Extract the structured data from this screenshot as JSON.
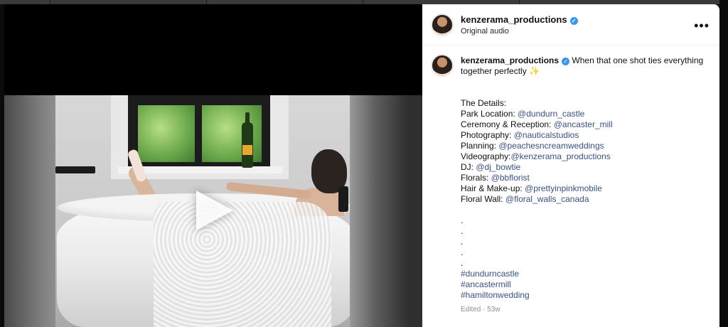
{
  "post": {
    "username": "kenzerama_productions",
    "audio": "Original audio",
    "caption_text": "When that one shot ties everything together perfectly ✨",
    "details_header": "The Details:",
    "details": [
      {
        "label": "Park Location: ",
        "mention": "@dundurn_castle"
      },
      {
        "label": "Ceremony & Reception: ",
        "mention": "@ancaster_mill"
      },
      {
        "label": "Photography: ",
        "mention": "@nauticalstudios"
      },
      {
        "label": "Planning: ",
        "mention": "@peachesncreamweddings"
      },
      {
        "label": "Videography:",
        "mention": "@kenzerama_productions"
      },
      {
        "label": "DJ: ",
        "mention": "@dj_bowtie"
      },
      {
        "label": "Florals: ",
        "mention": "@bbflorist"
      },
      {
        "label": "Hair & Make-up: ",
        "mention": "@prettyinpinkmobile"
      },
      {
        "label": "Floral Wall: ",
        "mention": "@floral_walls_canada"
      }
    ],
    "dots": [
      ".",
      ".",
      ".",
      ".",
      "."
    ],
    "hashtags": [
      "#dundurncastle",
      "#ancastermill",
      "#hamiltonwedding"
    ],
    "edited": "Edited · 53w"
  },
  "icons": {
    "verified": "verified-badge-icon",
    "more": "more-options-icon",
    "play": "play-icon"
  },
  "colors": {
    "mention": "#385185",
    "verified": "#3897f0"
  }
}
